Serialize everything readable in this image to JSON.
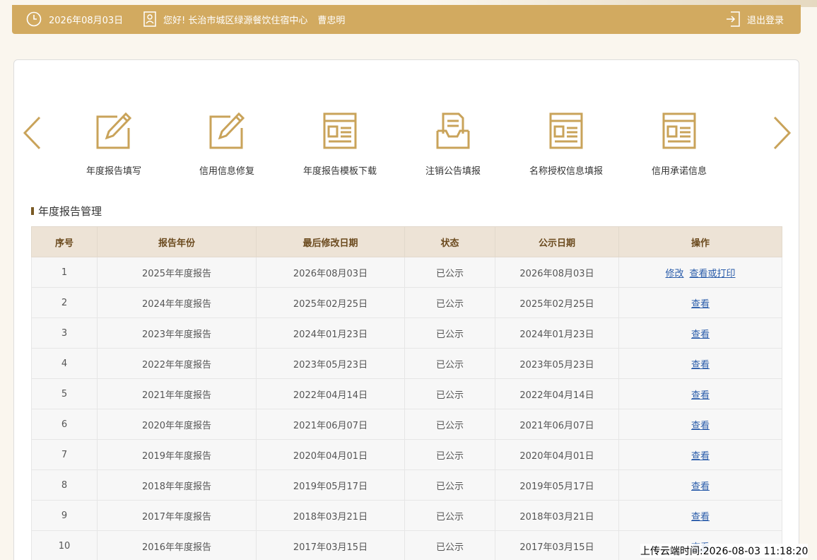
{
  "topbar": {
    "date": "2026年08月03日",
    "greeting": "您好!  长治市城区绿源餐饮住宿中心",
    "user": "曹忠明",
    "logout_label": "退出登录"
  },
  "nav": {
    "items": [
      {
        "label": "年度报告填写",
        "icon": "edit-form-icon"
      },
      {
        "label": "信用信息修复",
        "icon": "edit-form-icon"
      },
      {
        "label": "年度报告模板下载",
        "icon": "document-window-icon"
      },
      {
        "label": "注销公告填报",
        "icon": "inbox-document-icon"
      },
      {
        "label": "名称授权信息填报",
        "icon": "document-window-icon"
      },
      {
        "label": "信用承诺信息",
        "icon": "document-window-icon"
      }
    ]
  },
  "section": {
    "title": "年度报告管理"
  },
  "table": {
    "headers": [
      "序号",
      "报告年份",
      "最后修改日期",
      "状态",
      "公示日期",
      "操作"
    ],
    "rows": [
      {
        "no": "1",
        "year": "2025年年度报告",
        "modified": "2026年08月03日",
        "status": "已公示",
        "published": "2026年08月03日",
        "actions": [
          "修改",
          "查看或打印"
        ]
      },
      {
        "no": "2",
        "year": "2024年年度报告",
        "modified": "2025年02月25日",
        "status": "已公示",
        "published": "2025年02月25日",
        "actions": [
          "查看"
        ]
      },
      {
        "no": "3",
        "year": "2023年年度报告",
        "modified": "2024年01月23日",
        "status": "已公示",
        "published": "2024年01月23日",
        "actions": [
          "查看"
        ]
      },
      {
        "no": "4",
        "year": "2022年年度报告",
        "modified": "2023年05月23日",
        "status": "已公示",
        "published": "2023年05月23日",
        "actions": [
          "查看"
        ]
      },
      {
        "no": "5",
        "year": "2021年年度报告",
        "modified": "2022年04月14日",
        "status": "已公示",
        "published": "2022年04月14日",
        "actions": [
          "查看"
        ]
      },
      {
        "no": "6",
        "year": "2020年年度报告",
        "modified": "2021年06月07日",
        "status": "已公示",
        "published": "2021年06月07日",
        "actions": [
          "查看"
        ]
      },
      {
        "no": "7",
        "year": "2019年年度报告",
        "modified": "2020年04月01日",
        "status": "已公示",
        "published": "2020年04月01日",
        "actions": [
          "查看"
        ]
      },
      {
        "no": "8",
        "year": "2018年年度报告",
        "modified": "2019年05月17日",
        "status": "已公示",
        "published": "2019年05月17日",
        "actions": [
          "查看"
        ]
      },
      {
        "no": "9",
        "year": "2017年年度报告",
        "modified": "2018年03月21日",
        "status": "已公示",
        "published": "2018年03月21日",
        "actions": [
          "查看"
        ]
      },
      {
        "no": "10",
        "year": "2016年年度报告",
        "modified": "2017年03月15日",
        "status": "已公示",
        "published": "2017年03月15日",
        "actions": [
          "查看"
        ]
      }
    ]
  },
  "upload_time": "上传云端时间:2026-08-03 11:18:20",
  "colors": {
    "accent": "#d2aa60",
    "icon": "#c9a35a",
    "header_bg": "#ede3d6",
    "link": "#2a5caa"
  }
}
